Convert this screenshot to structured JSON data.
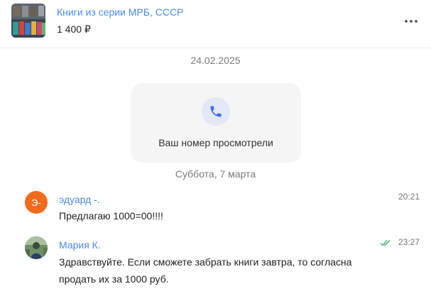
{
  "listing": {
    "title": "Книги из серии МРБ, СССР",
    "price": "1 400 ₽",
    "more_icon": "more-dots-icon"
  },
  "timeline": {
    "date_1": "24.02.2025",
    "event_text": "Ваш номер просмотрели",
    "event_icon": "phone-icon",
    "date_2": "Суббота, 7 марта"
  },
  "messages": [
    {
      "author": "эдуард -.",
      "avatar_letter": "Э-",
      "text_lines": [
        "Предлагаю 1000=00!!!!"
      ],
      "time": "20:21"
    },
    {
      "author": "Мария К.",
      "text_lines": [
        "Здравствуйте. Если сможете забрать книги завтра, то согласна",
        "продать их за 1000 руб."
      ],
      "time": "23:27",
      "status_icon": "double-check-icon"
    }
  ],
  "colors": {
    "link_blue": "#4a8be8",
    "avatar_orange": "#f26b1d",
    "read_green": "#3cb46e",
    "event_bg": "#f5f5f5"
  }
}
